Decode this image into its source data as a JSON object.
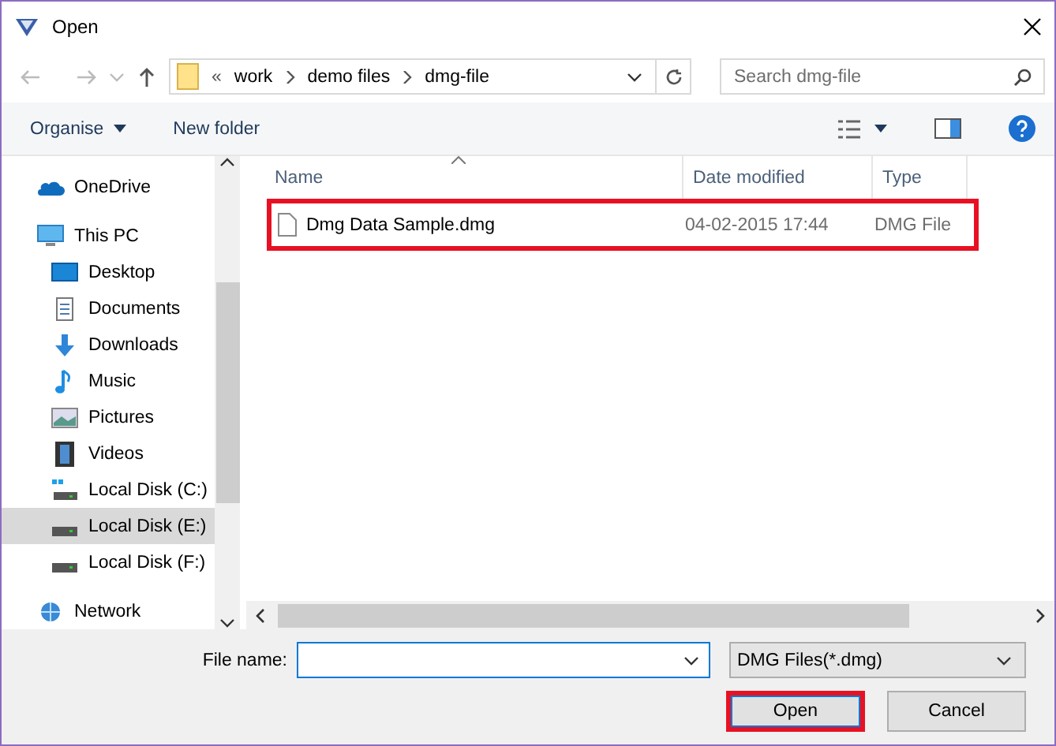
{
  "window": {
    "title": "Open"
  },
  "address": {
    "overflow": "«",
    "path": [
      "work",
      "demo files",
      "dmg-file"
    ]
  },
  "search": {
    "placeholder": "Search dmg-file"
  },
  "toolbar": {
    "buttons": [
      {
        "label": "Organise",
        "dropdown": true
      },
      {
        "label": "New folder",
        "dropdown": false
      }
    ]
  },
  "sidebar": {
    "items": [
      {
        "label": "OneDrive",
        "kind": "cloud",
        "selected": false
      },
      {
        "label": "This PC",
        "kind": "pc",
        "selected": false,
        "children": [
          {
            "label": "Desktop",
            "kind": "desktop",
            "selected": false
          },
          {
            "label": "Documents",
            "kind": "documents",
            "selected": false
          },
          {
            "label": "Downloads",
            "kind": "downloads",
            "selected": false
          },
          {
            "label": "Music",
            "kind": "music",
            "selected": false
          },
          {
            "label": "Pictures",
            "kind": "pictures",
            "selected": false
          },
          {
            "label": "Videos",
            "kind": "videos",
            "selected": false
          },
          {
            "label": "Local Disk (C:)",
            "kind": "system-disk",
            "selected": false
          },
          {
            "label": "Local Disk (E:)",
            "kind": "disk",
            "selected": true
          },
          {
            "label": "Local Disk (F:)",
            "kind": "disk",
            "selected": false
          }
        ]
      },
      {
        "label": "Network",
        "kind": "network",
        "selected": false
      }
    ]
  },
  "columns": [
    {
      "label": "Name",
      "sorted": true
    },
    {
      "label": "Date modified",
      "sorted": false
    },
    {
      "label": "Type",
      "sorted": false
    }
  ],
  "files": [
    {
      "name": "Dmg Data Sample.dmg",
      "date": "04-02-2015 17:44",
      "type": "DMG File",
      "highlighted": true
    }
  ],
  "file_name": {
    "label": "File name:"
  },
  "file_type": {
    "value": "DMG Files(*.dmg)"
  },
  "buttons": [
    {
      "label": "Open",
      "highlighted": true
    },
    {
      "label": "Cancel",
      "highlighted": false
    }
  ]
}
